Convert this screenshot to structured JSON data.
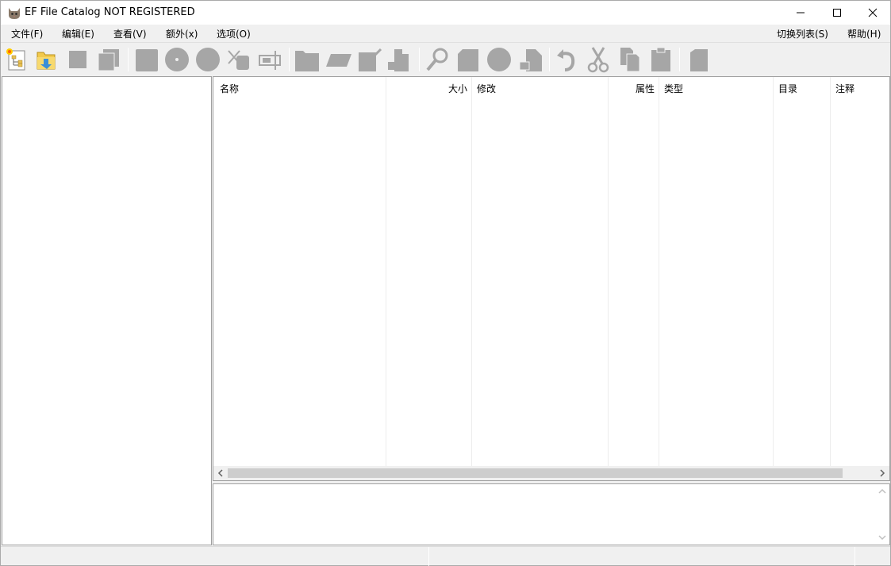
{
  "window": {
    "title": "EF File Catalog NOT REGISTERED",
    "icon": "cat-app-icon"
  },
  "menu": {
    "left": [
      {
        "label": "文件(F)"
      },
      {
        "label": "编辑(E)"
      },
      {
        "label": "查看(V)"
      },
      {
        "label": "额外(x)"
      },
      {
        "label": "选项(O)"
      }
    ],
    "right": [
      {
        "label": "切换列表(S)"
      },
      {
        "label": "帮助(H)"
      }
    ]
  },
  "toolbar": {
    "buttons": [
      {
        "icon": "new-catalog-icon",
        "enabled": true
      },
      {
        "icon": "open-catalog-icon",
        "enabled": true
      },
      {
        "icon": "save-icon",
        "enabled": false
      },
      {
        "icon": "save-all-icon",
        "enabled": false
      },
      {
        "icon": "add-disk-icon",
        "enabled": false
      },
      {
        "icon": "cd-icon",
        "enabled": false
      },
      {
        "icon": "disc-icon",
        "enabled": false
      },
      {
        "icon": "delete-disk-icon",
        "enabled": false
      },
      {
        "icon": "rename-disk-icon",
        "enabled": false
      },
      {
        "icon": "folder-icon",
        "enabled": false
      },
      {
        "icon": "scan-icon",
        "enabled": false
      },
      {
        "icon": "edit-icon",
        "enabled": false
      },
      {
        "icon": "properties-icon",
        "enabled": false
      },
      {
        "icon": "search-icon",
        "enabled": false
      },
      {
        "icon": "copy-page-icon",
        "enabled": false
      },
      {
        "icon": "circle-icon",
        "enabled": false
      },
      {
        "icon": "export-icon",
        "enabled": false
      },
      {
        "icon": "undo-icon",
        "enabled": false
      },
      {
        "icon": "cut-icon",
        "enabled": false
      },
      {
        "icon": "copy-icon",
        "enabled": false
      },
      {
        "icon": "paste-icon",
        "enabled": false
      },
      {
        "icon": "info-icon",
        "enabled": false
      }
    ]
  },
  "file_list": {
    "columns": [
      {
        "label": "名称",
        "align": "left"
      },
      {
        "label": "大小",
        "align": "right"
      },
      {
        "label": "修改",
        "align": "left"
      },
      {
        "label": "属性",
        "align": "right"
      },
      {
        "label": "类型",
        "align": "left"
      },
      {
        "label": "目录",
        "align": "left"
      },
      {
        "label": "注释",
        "align": "left"
      }
    ],
    "rows": []
  },
  "colors": {
    "disabled_icon": "#a6a6a6",
    "window_bg": "#f0f0f0",
    "pane_bg": "#ffffff"
  }
}
